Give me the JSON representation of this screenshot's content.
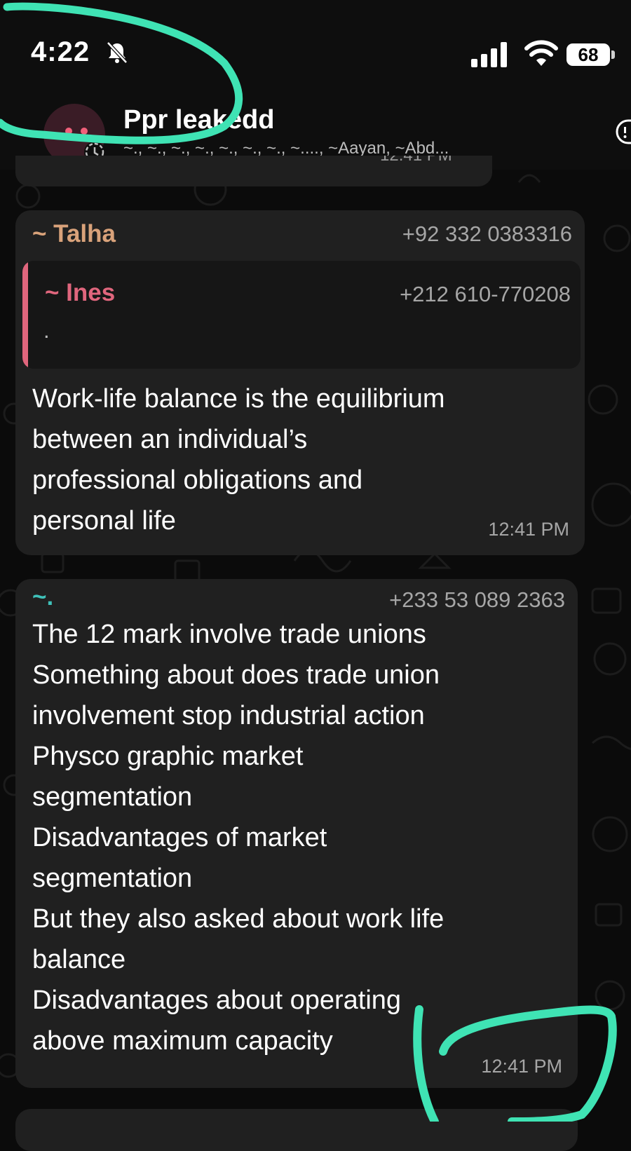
{
  "status_bar": {
    "time": "4:22",
    "battery": "68",
    "icons": [
      "bell-slash-icon",
      "cellular-signal-icon",
      "wifi-icon",
      "battery-icon"
    ]
  },
  "chat": {
    "title": "Ppr leakedd",
    "members": "~., ~., ~., ~., ~., ~., ~., ~...., ~Aayan, ~Abd...",
    "previous_time": "12:41 PM"
  },
  "messages": [
    {
      "sender": "~ Talha",
      "phone": "+92 332 0383316",
      "sender_color": "#d9a27a",
      "quote": {
        "sender": "~ Ines",
        "phone": "+212 610-770208",
        "text": ".",
        "color": "#e0667d"
      },
      "text": "Work-life balance is the equilibrium\nbetween an individual’s\nprofessional obligations and\npersonal life",
      "time": "12:41 PM"
    },
    {
      "sender": "~.",
      "phone": "+233 53 089 2363",
      "sender_color": "#3fc1b9",
      "text": "The 12 mark involve trade unions\nSomething about does trade union\ninvolvement stop industrial action\nPhysco graphic market\nsegmentation\nDisadvantages of market\nsegmentation\nBut they also asked about work life\nbalance\nDisadvantages about operating\nabove maximum capacity",
      "time": "12:41 PM"
    }
  ],
  "colors": {
    "background": "#0b0b0b",
    "bubble": "#202020",
    "annotation": "#3fe3b4"
  }
}
